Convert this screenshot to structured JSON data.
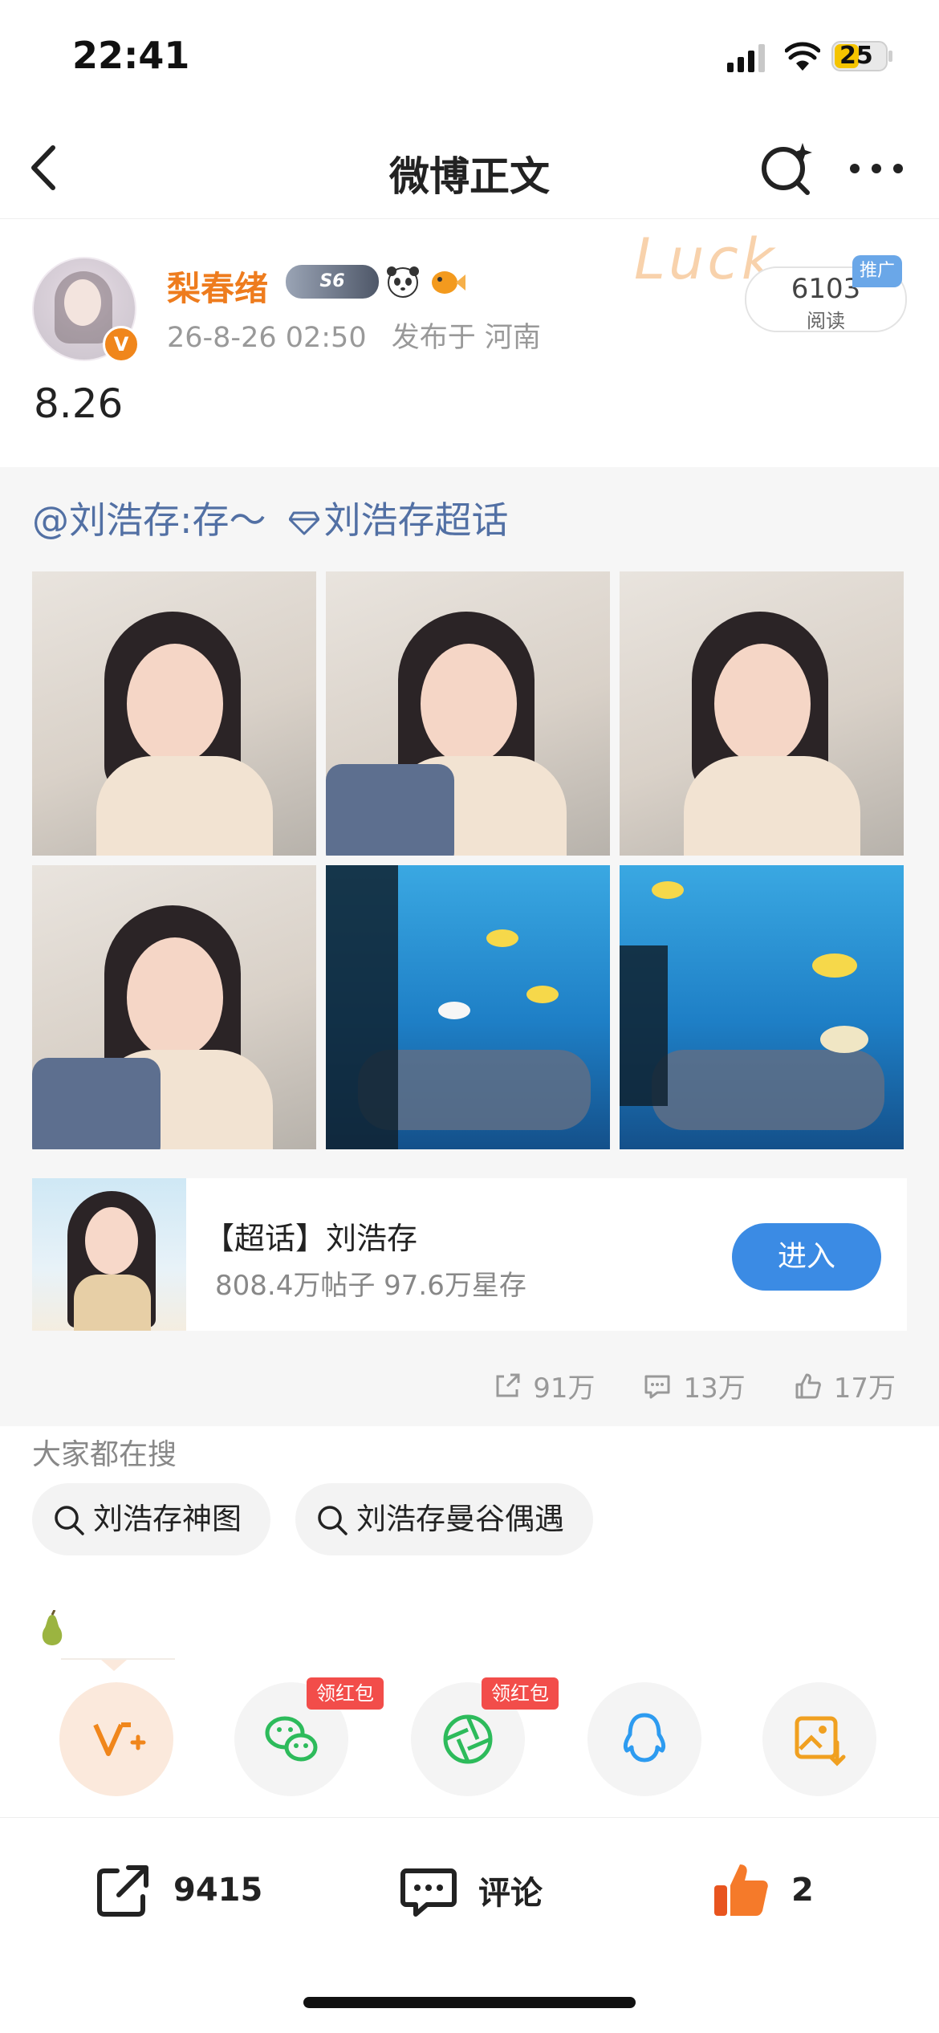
{
  "status_bar": {
    "time": "22:41",
    "battery": "25"
  },
  "nav": {
    "title": "微博正文"
  },
  "post": {
    "username": "梨春绪",
    "badge_text": "S6",
    "date": "26-8-26 02:50",
    "location": "发布于 河南",
    "decoration": "Luck",
    "reads_count": "6103",
    "reads_label": "阅读",
    "promo_label": "推广",
    "text": "8.26"
  },
  "repost": {
    "mention": "@刘浩存:存～",
    "supertopic_link": "刘浩存超话",
    "photos": [
      "portrait",
      "portrait",
      "portrait",
      "portrait",
      "aquarium",
      "aquarium"
    ],
    "topic_card": {
      "name": "【超话】刘浩存",
      "stats": "808.4万帖子 97.6万星存",
      "enter_label": "进入"
    },
    "actions": {
      "shares": "91万",
      "comments": "13万",
      "likes": "17万"
    }
  },
  "searches": {
    "title": "大家都在搜",
    "items": [
      "刘浩存神图",
      "刘浩存曼谷偶遇"
    ]
  },
  "share_row": {
    "red_packet_label": "领红包",
    "targets": [
      "weibo-vplus-icon",
      "wechat-icon",
      "moments-icon",
      "qq-icon",
      "save-image-icon"
    ]
  },
  "bottom_bar": {
    "share_count": "9415",
    "comment_label": "评论",
    "like_count": "2"
  },
  "colors": {
    "accent_orange": "#ee7c1e",
    "link_blue": "#5270a4",
    "enter_button": "#3b8be4",
    "red_packet": "#f24d4a"
  }
}
